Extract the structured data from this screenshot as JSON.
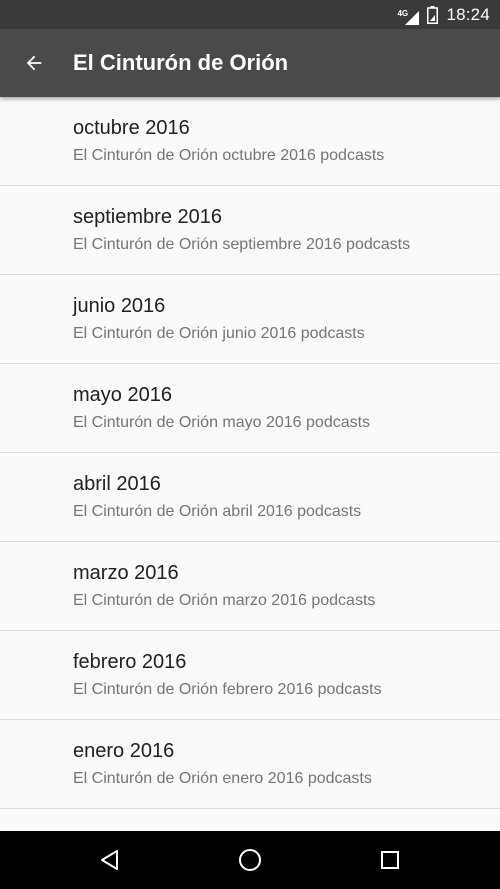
{
  "status_bar": {
    "network": "4G",
    "time": "18:24"
  },
  "app_bar": {
    "title": "El Cinturón de Orión",
    "back_icon": "arrow-back-icon"
  },
  "list": {
    "items": [
      {
        "title": "octubre 2016",
        "subtitle": "El Cinturón de Orión octubre 2016 podcasts"
      },
      {
        "title": "septiembre 2016",
        "subtitle": "El Cinturón de Orión septiembre 2016 podcasts"
      },
      {
        "title": "junio 2016",
        "subtitle": "El Cinturón de Orión junio 2016 podcasts"
      },
      {
        "title": "mayo 2016",
        "subtitle": "El Cinturón de Orión mayo 2016 podcasts"
      },
      {
        "title": "abril 2016",
        "subtitle": "El Cinturón de Orión abril 2016 podcasts"
      },
      {
        "title": "marzo 2016",
        "subtitle": "El Cinturón de Orión marzo 2016 podcasts"
      },
      {
        "title": "febrero 2016",
        "subtitle": "El Cinturón de Orión febrero 2016 podcasts"
      },
      {
        "title": "enero 2016",
        "subtitle": "El Cinturón de Orión enero 2016 podcasts"
      }
    ]
  },
  "nav_bar": {
    "icons": [
      "nav-back-icon",
      "nav-home-icon",
      "nav-recents-icon"
    ]
  },
  "colors": {
    "status_bar": "#3a3a3a",
    "app_bar": "#4a4a4a",
    "background": "#fafafa",
    "title_text": "#212121",
    "subtitle_text": "#757575",
    "nav_bar": "#000000"
  }
}
